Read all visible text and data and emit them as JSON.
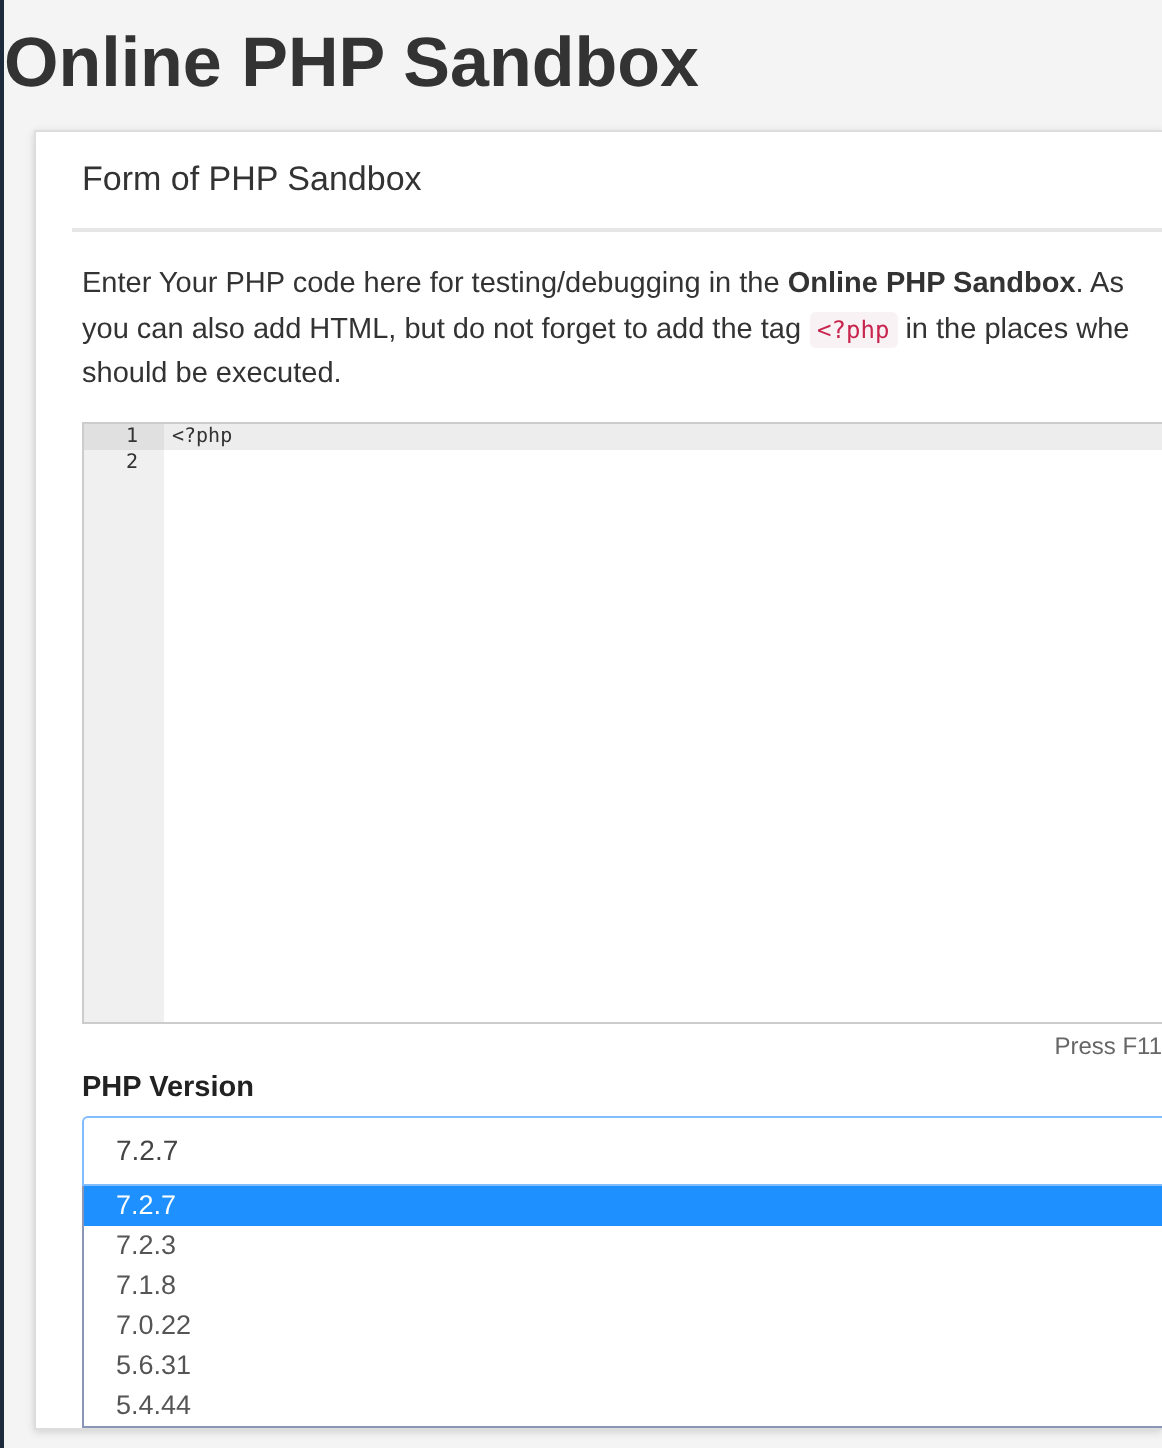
{
  "page_title": "Online PHP Sandbox",
  "card": {
    "title": "Form of PHP Sandbox",
    "intro": [
      {
        "kind": "text",
        "text": "Enter Your PHP code here for testing/debugging in the **Online PHP Sandbox**. As"
      },
      {
        "kind": "break"
      },
      {
        "kind": "text",
        "text": "you can also add HTML, but do not forget to add the tag "
      },
      {
        "kind": "code",
        "text": "<?php"
      },
      {
        "kind": "text",
        "text": " in the places whe"
      },
      {
        "kind": "break"
      },
      {
        "kind": "text",
        "text": "should be executed."
      }
    ],
    "editor": {
      "lines": [
        {
          "number": "1",
          "text": "<?php",
          "active": true
        },
        {
          "number": "2",
          "active": false
        }
      ]
    },
    "editor_hint": "Press F11",
    "version_label": "PHP Version",
    "version_select": {
      "value": "7.2.7",
      "options": [
        {
          "label": "7.2.7",
          "selected": true
        },
        {
          "label": "7.2.3",
          "selected": false
        },
        {
          "label": "7.1.8",
          "selected": false
        },
        {
          "label": "7.0.22",
          "selected": false
        },
        {
          "label": "5.6.31",
          "selected": false
        },
        {
          "label": "5.4.44",
          "selected": false
        }
      ]
    }
  }
}
